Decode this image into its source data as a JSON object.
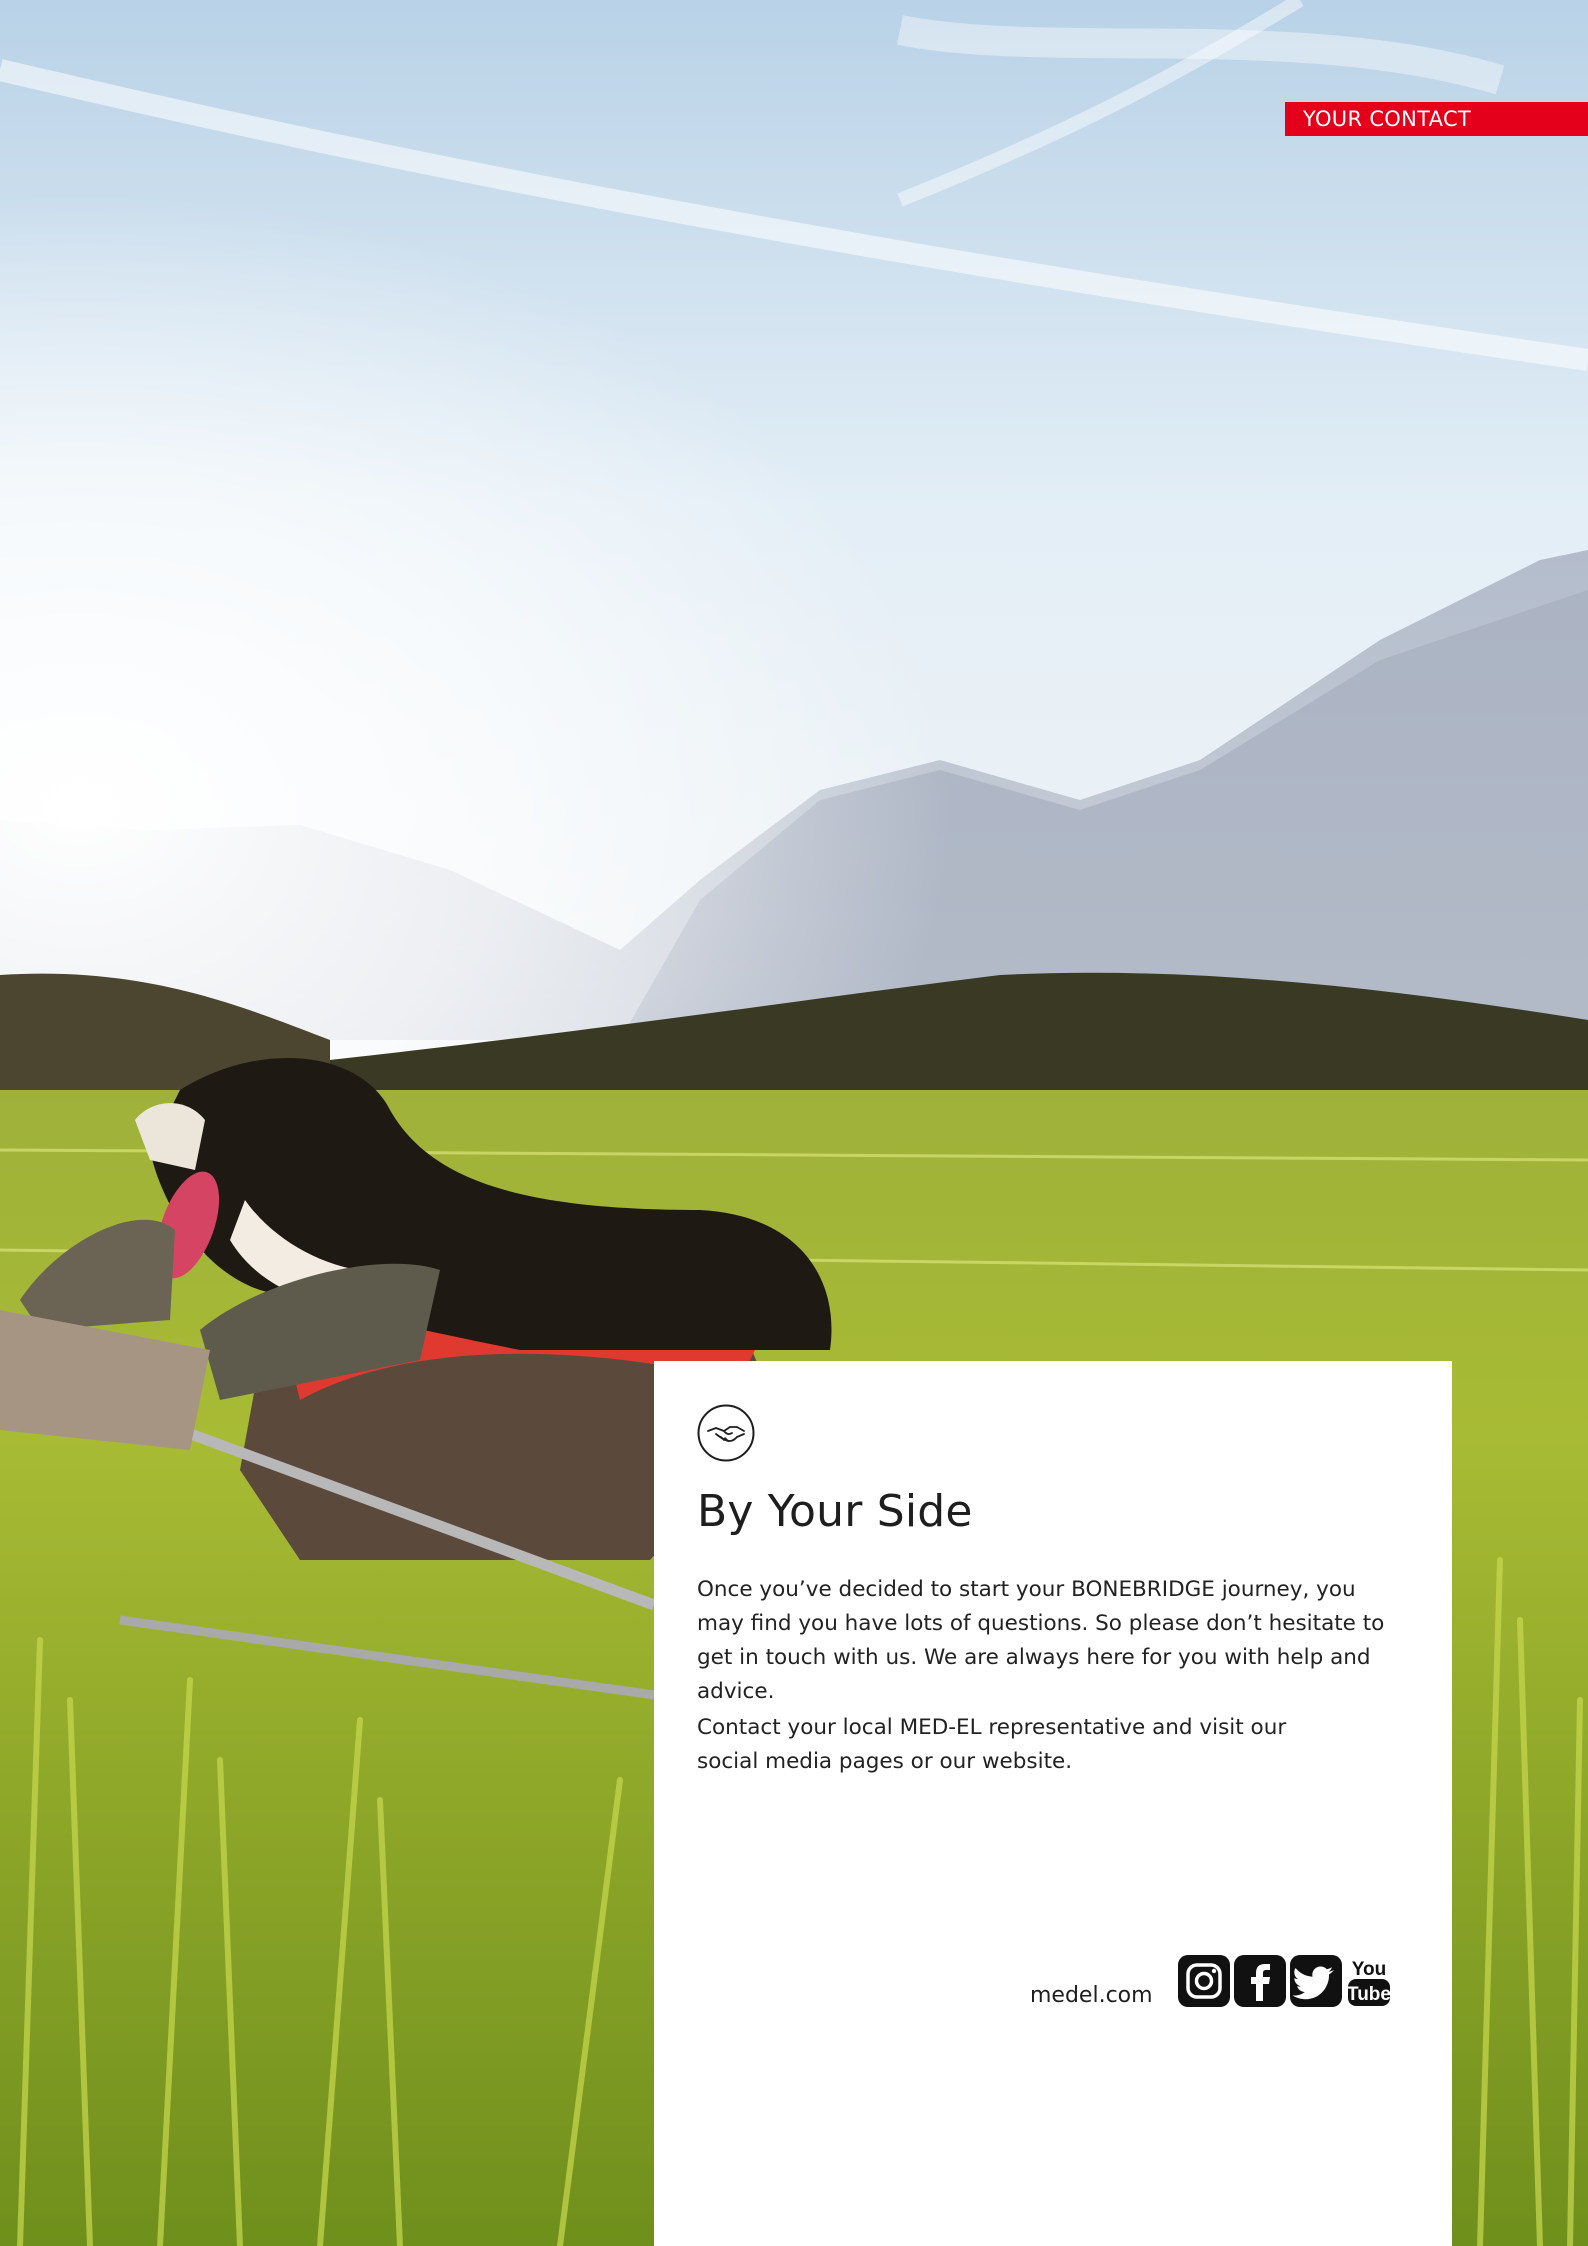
{
  "header": {
    "contact_tag": "YOUR CONTACT"
  },
  "card": {
    "icon": "handshake-icon",
    "title": "By Your Side",
    "paragraph_1": "Once you’ve decided to start your BONEBRIDGE journey, you may find you have lots of questions. So please don’t hesitate to get in touch with us. We are always here for you with help and advice.",
    "paragraph_2": "Contact your local MED-EL representative and visit our social media pages or our website.",
    "website": "medel.com",
    "social": {
      "icons": [
        "instagram-icon",
        "facebook-icon",
        "twitter-icon",
        "youtube-icon"
      ],
      "youtube_top": "You",
      "youtube_bottom": "Tube"
    }
  },
  "colors": {
    "accent": "#e4001b",
    "card_bg": "#ffffff",
    "text": "#1e1e1e"
  }
}
